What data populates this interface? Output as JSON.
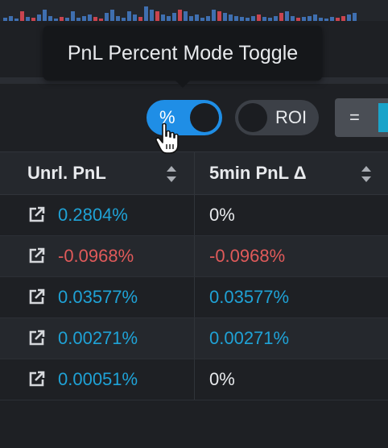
{
  "tooltip": {
    "text": "PnL Percent Mode Toggle"
  },
  "toggles": {
    "percent_label": "%",
    "percent_on": true,
    "roi_label": "ROI",
    "roi_on": false,
    "equal_label": "="
  },
  "table": {
    "columns": [
      "Unrl. PnL",
      "5min PnL Δ"
    ],
    "rows": [
      {
        "unrl": "0.2804%",
        "unrl_tone": "pos",
        "delta": "0%",
        "delta_tone": "neutral"
      },
      {
        "unrl": "-0.0968%",
        "unrl_tone": "neg",
        "delta": "-0.0968%",
        "delta_tone": "neg"
      },
      {
        "unrl": "0.03577%",
        "unrl_tone": "pos",
        "delta": "0.03577%",
        "delta_tone": "pos"
      },
      {
        "unrl": "0.00271%",
        "unrl_tone": "pos",
        "delta": "0.00271%",
        "delta_tone": "pos"
      },
      {
        "unrl": "0.00051%",
        "unrl_tone": "pos",
        "delta": "0%",
        "delta_tone": "neutral"
      }
    ]
  },
  "colors": {
    "accent": "#1f8ee6",
    "positive": "#1fa2d6",
    "negative": "#e05a5a",
    "background": "#1e2024"
  },
  "icons": {
    "row_link": "external-link-icon",
    "sort": "sort-icon",
    "cursor": "hand-pointer-icon"
  }
}
